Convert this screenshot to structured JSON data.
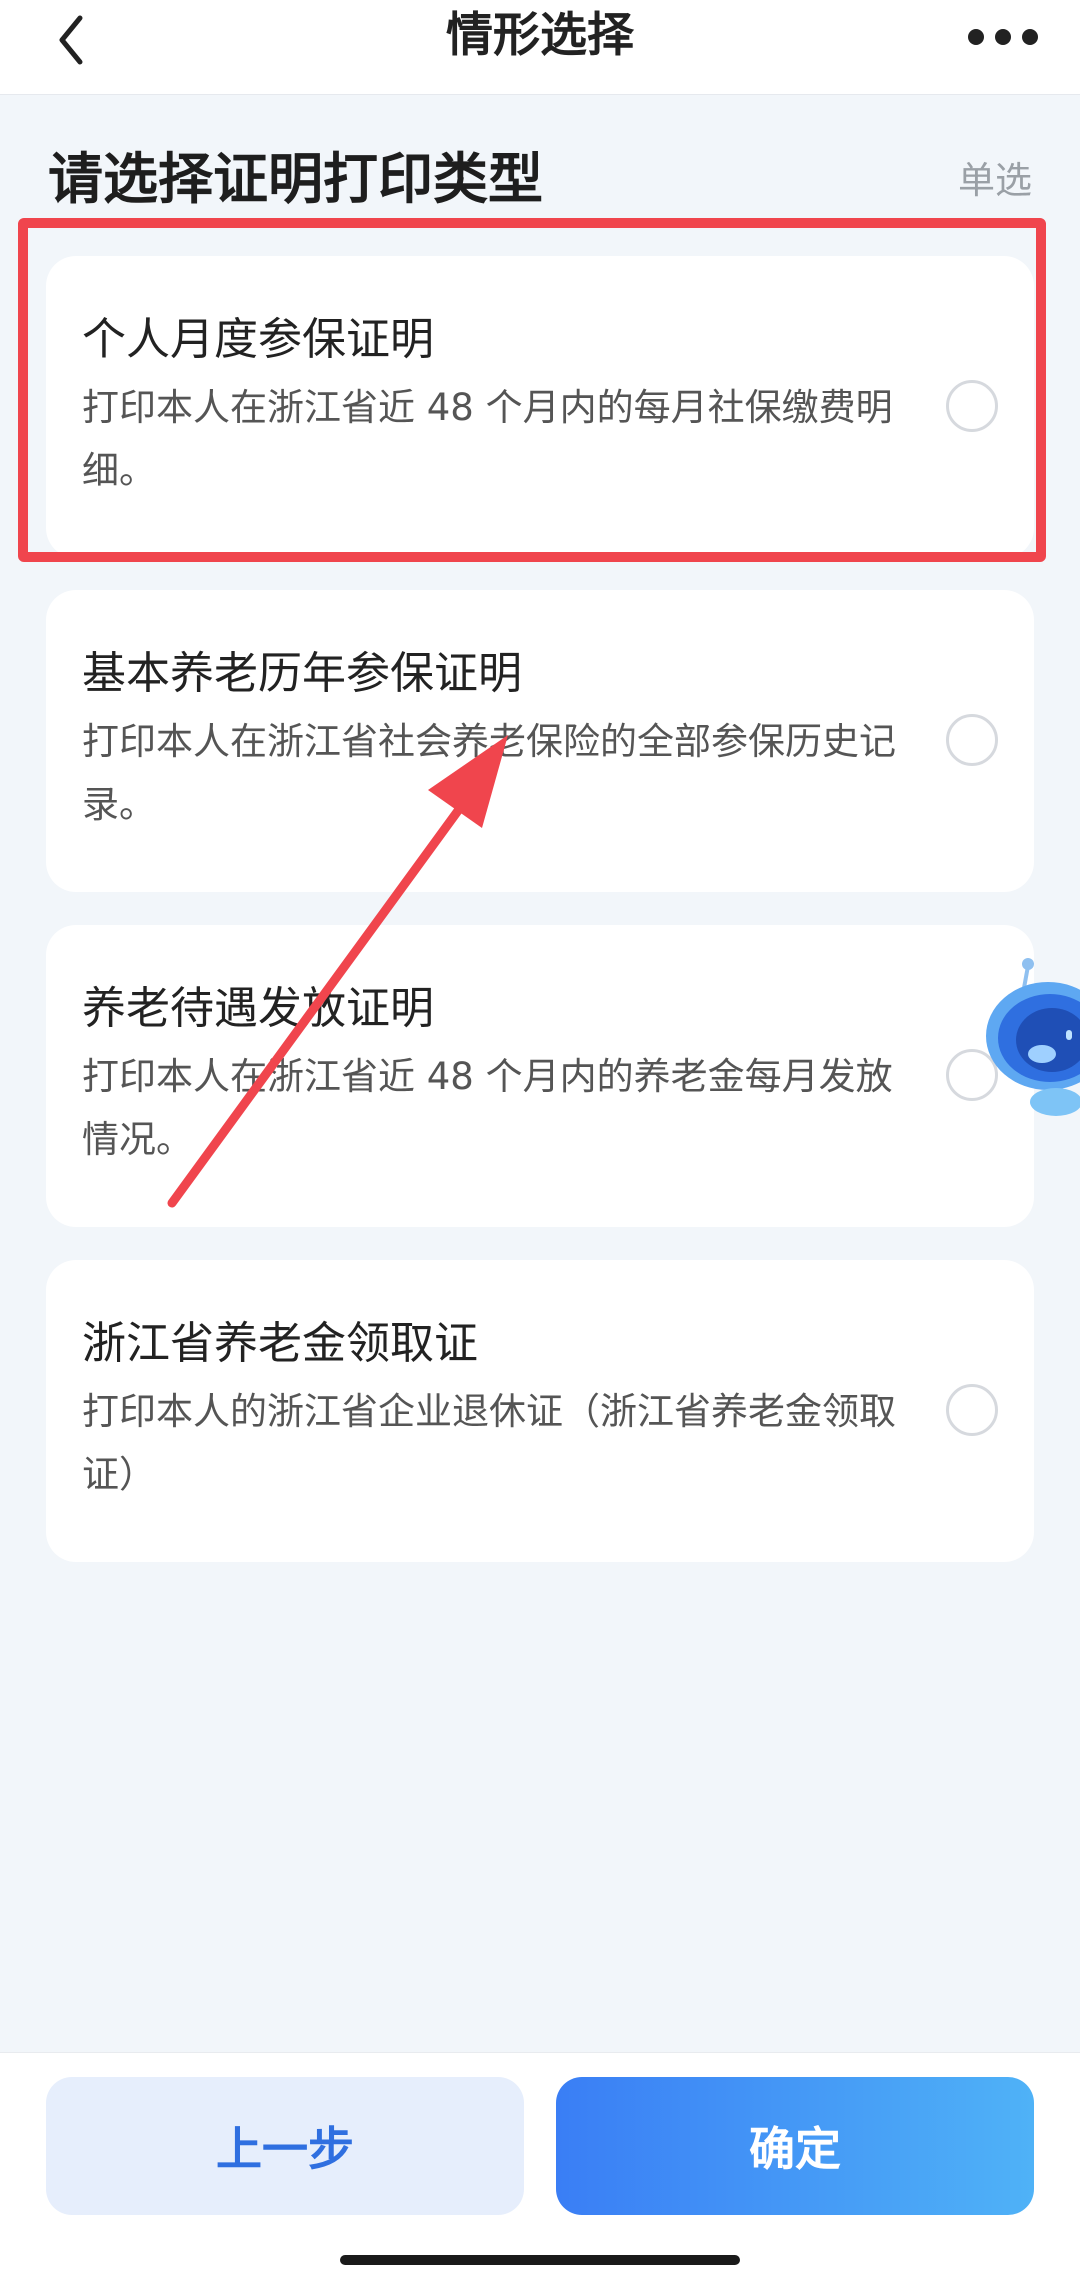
{
  "nav": {
    "title": "情形选择",
    "back_icon": "chevron-left-icon",
    "more_icon": "more-dots-icon"
  },
  "section": {
    "title": "请选择证明打印类型",
    "mode": "单选"
  },
  "options": [
    {
      "title": "个人月度参保证明",
      "desc": "打印本人在浙江省近 48 个月内的每月社保缴费明细。",
      "selected": false
    },
    {
      "title": "基本养老历年参保证明",
      "desc": "打印本人在浙江省社会养老保险的全部参保历史记录。",
      "selected": false
    },
    {
      "title": "养老待遇发放证明",
      "desc": "打印本人在浙江省近 48 个月内的养老金每月发放情况。",
      "selected": false
    },
    {
      "title": "浙江省养老金领取证",
      "desc": "打印本人的浙江省企业退休证（浙江省养老金领取证）",
      "selected": false
    }
  ],
  "footer": {
    "prev_label": "上一步",
    "confirm_label": "确定"
  },
  "colors": {
    "accent": "#3a7ef5",
    "highlight": "#f0454d",
    "background": "#f2f6fa"
  }
}
